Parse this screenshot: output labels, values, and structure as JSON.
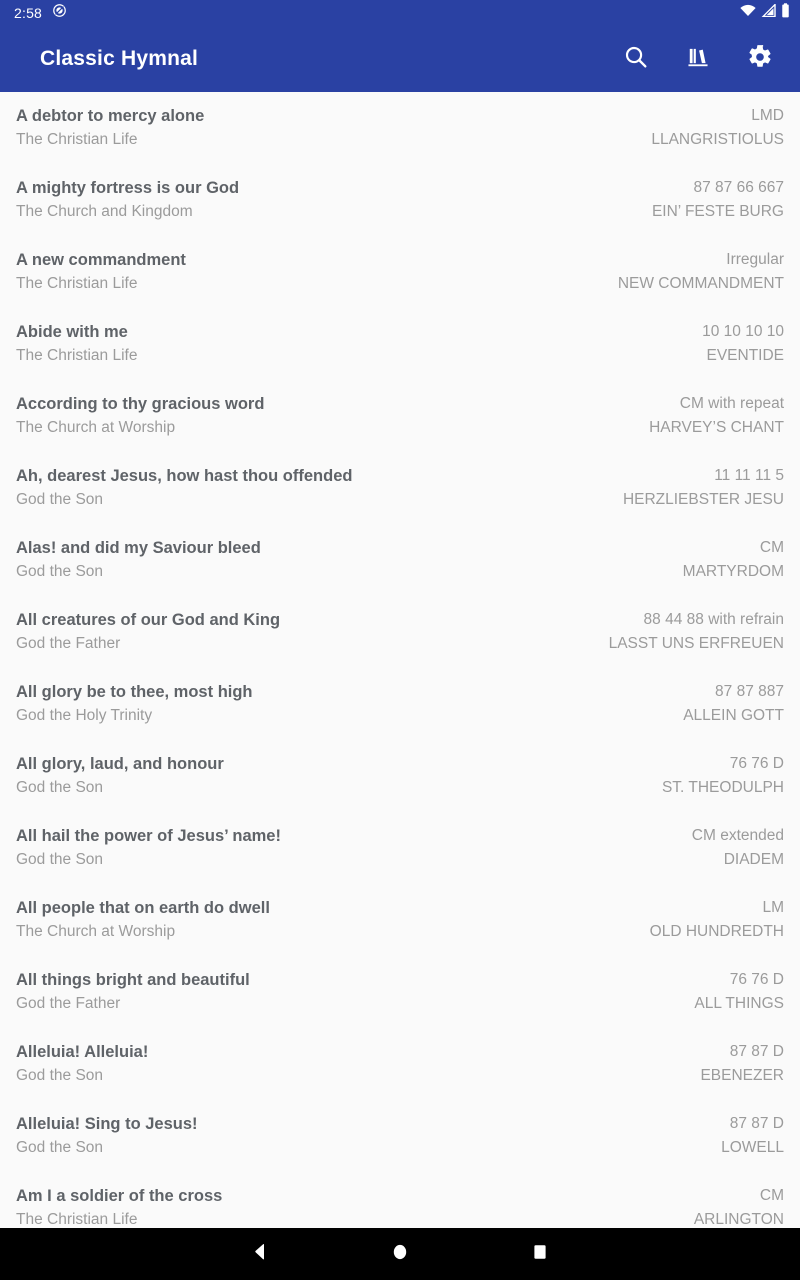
{
  "status_bar": {
    "time": "2:58",
    "icons": [
      "dnd-icon",
      "wifi-icon",
      "cellular-signal-icon",
      "battery-icon"
    ]
  },
  "app_bar": {
    "title": "Classic Hymnal",
    "actions": [
      {
        "name": "search-icon",
        "label": "Search"
      },
      {
        "name": "library-icon",
        "label": "Library"
      },
      {
        "name": "settings-gear-icon",
        "label": "Settings"
      }
    ]
  },
  "colors": {
    "app_bar": "#2A41A3",
    "background": "#fafafa",
    "title_text": "#5f6368",
    "secondary_text": "#9b9b9b",
    "nav_bar": "#000000"
  },
  "hymns": [
    {
      "title": "A debtor to mercy alone",
      "section": "The Christian Life",
      "meter": "LMD",
      "tune": "LLANGRISTIOLUS"
    },
    {
      "title": "A mighty fortress is our God",
      "section": "The Church and Kingdom",
      "meter": "87 87 66 667",
      "tune": "EIN’ FESTE BURG"
    },
    {
      "title": "A new commandment",
      "section": "The Christian Life",
      "meter": "Irregular",
      "tune": "NEW COMMANDMENT"
    },
    {
      "title": "Abide with me",
      "section": "The Christian Life",
      "meter": "10 10 10 10",
      "tune": "EVENTIDE"
    },
    {
      "title": "According to thy gracious word",
      "section": "The Church at Worship",
      "meter": "CM with repeat",
      "tune": "HARVEY’S CHANT"
    },
    {
      "title": "Ah, dearest Jesus, how hast thou offended",
      "section": "God the Son",
      "meter": "11 11 11 5",
      "tune": "HERZLIEBSTER JESU"
    },
    {
      "title": "Alas! and did my Saviour bleed",
      "section": "God the Son",
      "meter": "CM",
      "tune": "MARTYRDOM"
    },
    {
      "title": "All creatures of our God and King",
      "section": "God the Father",
      "meter": "88 44 88 with refrain",
      "tune": "LASST UNS ERFREUEN"
    },
    {
      "title": "All glory be to thee, most high",
      "section": "God the Holy Trinity",
      "meter": "87 87 887",
      "tune": "ALLEIN GOTT"
    },
    {
      "title": "All glory, laud, and honour",
      "section": "God the Son",
      "meter": "76 76 D",
      "tune": "ST. THEODULPH"
    },
    {
      "title": "All hail the power of Jesus’ name!",
      "section": "God the Son",
      "meter": "CM extended",
      "tune": "DIADEM"
    },
    {
      "title": "All people that on earth do dwell",
      "section": "The Church at Worship",
      "meter": "LM",
      "tune": "OLD HUNDREDTH"
    },
    {
      "title": "All things bright and beautiful",
      "section": "God the Father",
      "meter": "76 76 D",
      "tune": "ALL THINGS"
    },
    {
      "title": "Alleluia! Alleluia!",
      "section": "God the Son",
      "meter": "87 87 D",
      "tune": "EBENEZER"
    },
    {
      "title": "Alleluia! Sing to Jesus!",
      "section": "God the Son",
      "meter": "87 87 D",
      "tune": "LOWELL"
    },
    {
      "title": "Am I a soldier of the cross",
      "section": "The Christian Life",
      "meter": "CM",
      "tune": "ARLINGTON"
    }
  ],
  "nav_bar": {
    "buttons": [
      {
        "name": "back-button",
        "label": "Back"
      },
      {
        "name": "home-button",
        "label": "Home"
      },
      {
        "name": "recents-button",
        "label": "Recents"
      }
    ]
  }
}
